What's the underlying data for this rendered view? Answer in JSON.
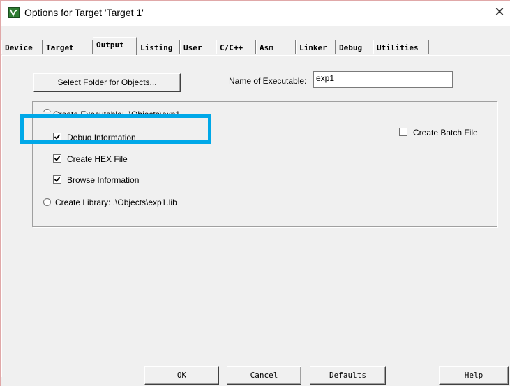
{
  "window": {
    "title": "Options for Target 'Target 1'"
  },
  "tabs": [
    {
      "label": "Device",
      "active": false
    },
    {
      "label": "Target",
      "active": false
    },
    {
      "label": "Output",
      "active": true
    },
    {
      "label": "Listing",
      "active": false
    },
    {
      "label": "User",
      "active": false
    },
    {
      "label": "C/C++",
      "active": false
    },
    {
      "label": "Asm",
      "active": false
    },
    {
      "label": "Linker",
      "active": false
    },
    {
      "label": "Debug",
      "active": false
    },
    {
      "label": "Utilities",
      "active": false
    }
  ],
  "output": {
    "select_folder_label": "Select Folder for Objects...",
    "name_of_executable_label": "Name of Executable:",
    "name_of_executable_value": "exp1",
    "create_executable_label": "Create Executable: .\\Objects\\exp1",
    "create_executable_selected": true,
    "debug_information_label": "Debug Information",
    "debug_information_checked": true,
    "create_hex_label": "Create HEX File",
    "create_hex_checked": true,
    "browse_information_label": "Browse Information",
    "browse_information_checked": true,
    "create_library_label": "Create Library:  .\\Objects\\exp1.lib",
    "create_library_selected": false,
    "create_batch_label": "Create Batch File",
    "create_batch_checked": false
  },
  "buttons": {
    "ok": "OK",
    "cancel": "Cancel",
    "defaults": "Defaults",
    "help": "Help"
  },
  "colors": {
    "highlight": "#00a8e8",
    "app_icon": "#2f7d32"
  }
}
